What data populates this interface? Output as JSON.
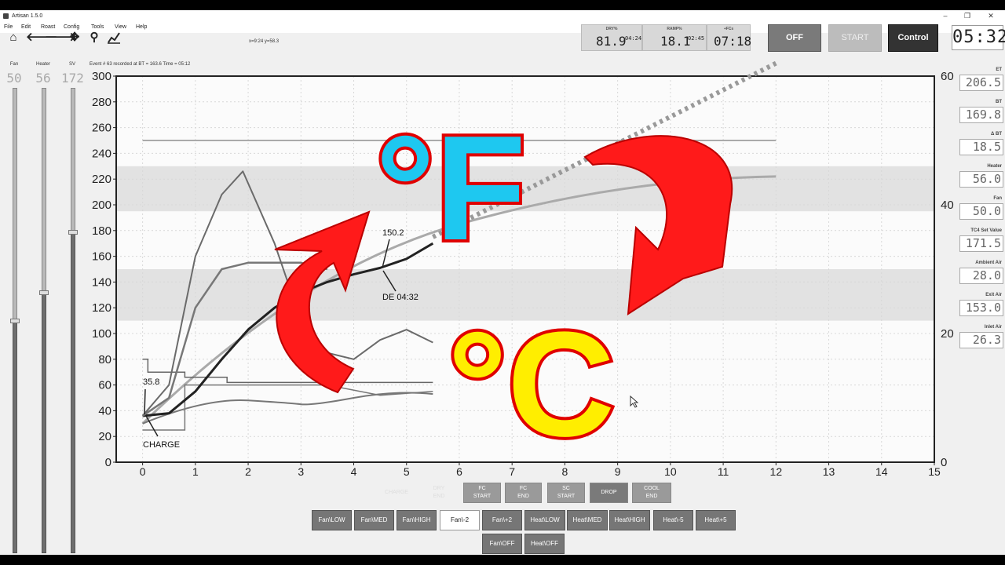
{
  "window": {
    "title": "Artisan 1.5.0",
    "controls": [
      "–",
      "❐",
      "✕"
    ]
  },
  "menu": [
    "File",
    "Edit",
    "Roast",
    "Config",
    "Tools",
    "View",
    "Help"
  ],
  "toolbar": {
    "cursor_readout": "x=9:24 y=58.3",
    "event_message": "Event # 63 recorded at BT = 163.6  Time = 05:12"
  },
  "lcds": {
    "dry": {
      "label": "DRY%",
      "value": "81.9",
      "time": "04:24"
    },
    "ramp": {
      "label": "RAMP%",
      "value": "18.1",
      "time": "02:45"
    },
    "fc": {
      "label": "+FCs",
      "value": "07:18"
    }
  },
  "buttons": {
    "off": "OFF",
    "start": "START",
    "control": "Control"
  },
  "clock": "05:32",
  "sliders": [
    {
      "label": "Fan",
      "value": "50",
      "level": 0.5
    },
    {
      "label": "Heater",
      "value": "56",
      "level": 0.56
    },
    {
      "label": "SV",
      "value": "172",
      "level": 0.69
    }
  ],
  "readouts": [
    {
      "label": "ET",
      "value": "206.5"
    },
    {
      "label": "BT",
      "value": "169.8"
    },
    {
      "label": "Δ BT",
      "value": "18.5"
    },
    {
      "label": "Heater",
      "value": "56.0"
    },
    {
      "label": "Fan",
      "value": "50.0"
    },
    {
      "label": "TC4 Set Value",
      "value": "171.5"
    },
    {
      "label": "Ambient Air",
      "value": "28.0"
    },
    {
      "label": "Exit Air",
      "value": "153.0"
    },
    {
      "label": "Inlet Air",
      "value": "26.3"
    }
  ],
  "chart_data": {
    "type": "line",
    "title": "",
    "xlabel": "",
    "ylabel": "",
    "xlim": [
      -0.5,
      15
    ],
    "ylim": [
      0,
      300
    ],
    "y2lim": [
      0,
      60
    ],
    "x_ticks": [
      "0",
      "1",
      "2",
      "3",
      "4",
      "5",
      "6",
      "7",
      "8",
      "9",
      "10",
      "11",
      "12",
      "13",
      "14",
      "15"
    ],
    "y_ticks": [
      "0",
      "20",
      "40",
      "60",
      "80",
      "100",
      "120",
      "140",
      "160",
      "180",
      "200",
      "220",
      "240",
      "260",
      "280",
      "300"
    ],
    "y2_ticks": [
      "0",
      "20",
      "40",
      "60"
    ],
    "grid": true,
    "series": [
      {
        "name": "",
        "x": [
          0,
          0.5,
          1,
          1.5,
          2,
          2.5,
          3,
          3.5,
          4,
          4.5,
          5,
          5.5
        ],
        "y": [
          36,
          38,
          55,
          80,
          103,
          120,
          132,
          140,
          146,
          151,
          158,
          170
        ]
      },
      {
        "name": "",
        "x": [
          0,
          0.5,
          1,
          1.5,
          2,
          2.5,
          3,
          3.5
        ],
        "y": [
          36,
          50,
          120,
          150,
          155,
          155,
          155,
          150
        ]
      },
      {
        "name": "",
        "x": [
          0,
          0.5,
          1,
          1.5,
          1.9,
          2.5,
          3,
          3.5,
          4,
          4.5,
          5,
          5.5
        ],
        "y": [
          36,
          60,
          160,
          208,
          226,
          170,
          110,
          85,
          80,
          95,
          103,
          93
        ]
      }
    ],
    "annotations": [
      {
        "text": "35.8"
      },
      {
        "text": "CHARGE"
      },
      {
        "text": "150.2"
      },
      {
        "text": "DE 04:32"
      }
    ]
  },
  "overlay": {
    "fahrenheit": "°F",
    "celsius": "°C"
  },
  "event_buttons_row1": [
    "CHARGE",
    "DRY END",
    "FC START",
    "FC END",
    "SC START",
    "DROP",
    "COOL END"
  ],
  "event_buttons_row2": [
    "Fan\\LOW",
    "Fan\\MED",
    "Fan\\HIGH",
    "Fan\\-2",
    "Fan\\+2",
    "Heat\\LOW",
    "Heat\\MED",
    "Heat\\HIGH",
    "Heat\\-5",
    "Heat\\+5"
  ],
  "event_buttons_row3": [
    "Fan\\OFF",
    "Heat\\OFF"
  ],
  "colors": {
    "arrow_red": "#ff1a1a",
    "f_fill": "#1ec8f0",
    "c_fill": "#ffee00",
    "outline": "#e00000"
  }
}
